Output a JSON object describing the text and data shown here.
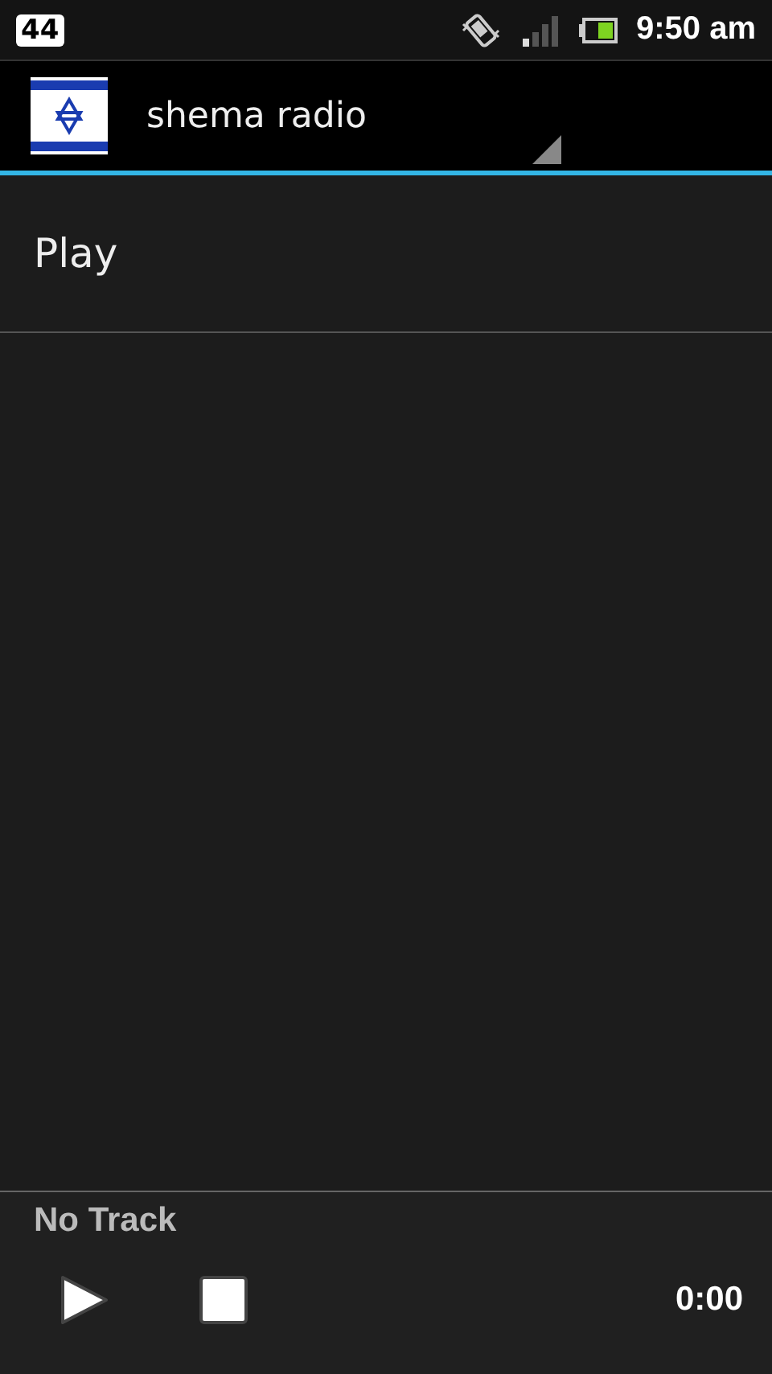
{
  "status_bar": {
    "notification_count": "44",
    "time": "9:50 am"
  },
  "action_bar": {
    "title": "shema radio"
  },
  "list": [
    {
      "label": "Play"
    }
  ],
  "player": {
    "track": "No Track",
    "time": "0:00"
  }
}
